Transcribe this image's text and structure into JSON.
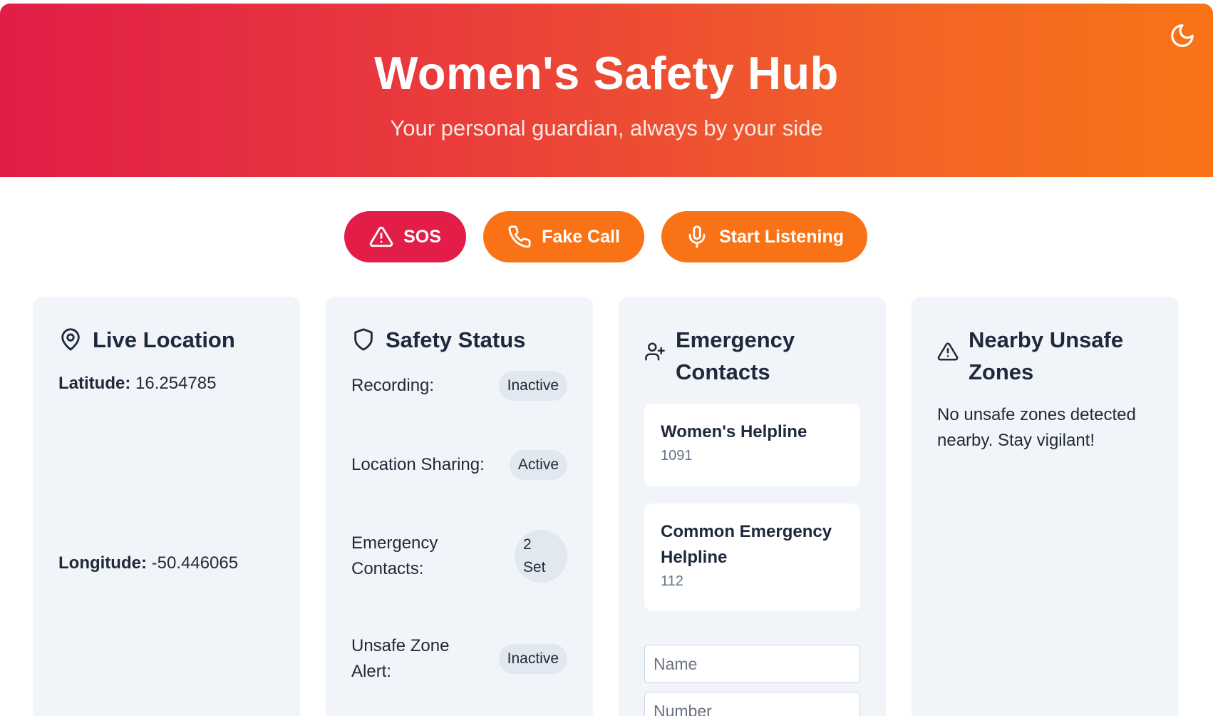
{
  "header": {
    "title": "Women's Safety Hub",
    "subtitle": "Your personal guardian, always by your side",
    "theme_icon": "moon-icon"
  },
  "actions": {
    "sos_label": "SOS",
    "fake_call_label": "Fake Call",
    "listen_label": "Start Listening"
  },
  "location": {
    "title": "Live Location",
    "latitude_label": "Latitude:",
    "latitude": "16.254785",
    "longitude_label": "Longitude:",
    "longitude": "-50.446065"
  },
  "status": {
    "title": "Safety Status",
    "rows": [
      {
        "label": "Recording:",
        "value": "Inactive"
      },
      {
        "label": "Location Sharing:",
        "value": "Active"
      },
      {
        "label": "Emergency Contacts:",
        "value_line1": "2",
        "value_line2": "Set"
      },
      {
        "label": "Unsafe Zone Alert:",
        "value": "Inactive"
      }
    ]
  },
  "contacts": {
    "title": "Emergency Contacts",
    "items": [
      {
        "name": "Women's Helpline",
        "number": "1091"
      },
      {
        "name": "Common Emergency Helpline",
        "number": "112"
      }
    ],
    "name_placeholder": "Name",
    "number_placeholder": "Number"
  },
  "unsafe": {
    "title": "Nearby Unsafe Zones",
    "message": "No unsafe zones detected nearby. Stay vigilant!"
  },
  "colors": {
    "sos": "#e11d48",
    "accent": "#f97316",
    "header_start": "#e11d48",
    "header_end": "#f97316"
  }
}
